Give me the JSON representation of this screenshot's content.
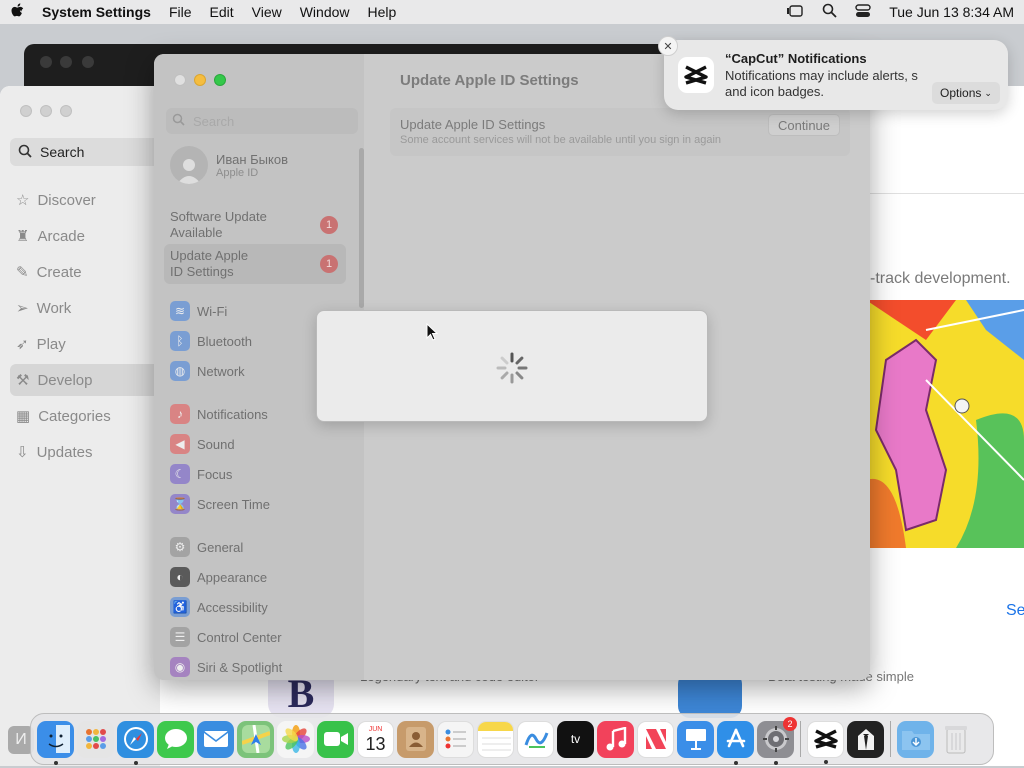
{
  "menubar": {
    "app": "System Settings",
    "items": [
      "File",
      "Edit",
      "View",
      "Window",
      "Help"
    ],
    "clock": "Tue Jun 13  8:34 AM"
  },
  "store": {
    "search": "Search",
    "nav": [
      {
        "label": "Discover",
        "icon": "star-icon"
      },
      {
        "label": "Arcade",
        "icon": "joystick-icon"
      },
      {
        "label": "Create",
        "icon": "brush-icon"
      },
      {
        "label": "Work",
        "icon": "paper-plane-icon"
      },
      {
        "label": "Play",
        "icon": "rocket-icon"
      },
      {
        "label": "Develop",
        "icon": "hammer-icon",
        "selected": true
      },
      {
        "label": "Categories",
        "icon": "grid-icon"
      },
      {
        "label": "Updates",
        "icon": "download-icon"
      }
    ],
    "hero_text": "-track development.",
    "see_link": "Se",
    "app1_text": "Legendary text and code editor",
    "app1_icon_letter": "B",
    "app2_text": "Beta testing made simple"
  },
  "settings": {
    "title": "Update Apple ID Settings",
    "search_placeholder": "Search",
    "profile": {
      "name": "Иван Быков",
      "sub": "Apple ID"
    },
    "alerts": [
      {
        "line1": "Software Update",
        "line2": "Available",
        "badge": "1"
      },
      {
        "line1": "Update Apple",
        "line2": "ID Settings",
        "badge": "1",
        "selected": true
      }
    ],
    "groups": [
      [
        {
          "label": "Wi-Fi",
          "icon": "wifi-icon",
          "color": "#7a9ed3"
        },
        {
          "label": "Bluetooth",
          "icon": "bluetooth-icon",
          "color": "#7a9ed3"
        },
        {
          "label": "Network",
          "icon": "globe-icon",
          "color": "#7a9ed3"
        }
      ],
      [
        {
          "label": "Notifications",
          "icon": "bell-icon",
          "color": "#d98484"
        },
        {
          "label": "Sound",
          "icon": "speaker-icon",
          "color": "#d98484"
        },
        {
          "label": "Focus",
          "icon": "moon-icon",
          "color": "#9486c9"
        },
        {
          "label": "Screen Time",
          "icon": "hourglass-icon",
          "color": "#9486c9"
        }
      ],
      [
        {
          "label": "General",
          "icon": "gear-icon",
          "color": "#a3a3a3"
        },
        {
          "label": "Appearance",
          "icon": "appearance-icon",
          "color": "#5a5a5a"
        },
        {
          "label": "Accessibility",
          "icon": "accessibility-icon",
          "color": "#7a9ed3"
        },
        {
          "label": "Control Center",
          "icon": "control-center-icon",
          "color": "#a3a3a3"
        },
        {
          "label": "Siri & Spotlight",
          "icon": "siri-icon",
          "color": "#a583c0"
        }
      ]
    ],
    "update_row": {
      "title": "Update Apple ID Settings",
      "subtitle": "Some account services will not be available until you sign in again",
      "button": "Continue"
    }
  },
  "notification": {
    "title": "“CapCut” Notifications",
    "line1": "Notifications may include alerts, s",
    "line2": "and icon badges.",
    "options": "Options"
  },
  "dock": {
    "apps": [
      {
        "name": "finder",
        "color": "#3b8ee8",
        "glyph": "☺",
        "running": true
      },
      {
        "name": "launchpad",
        "color": "#e5e5e5",
        "glyph": "▦",
        "running": false
      },
      {
        "name": "safari",
        "color": "#2f8fe0",
        "glyph": "⊕",
        "running": true
      },
      {
        "name": "messages",
        "color": "#3ec94d",
        "glyph": "💬",
        "running": false
      },
      {
        "name": "mail",
        "color": "#3a8de0",
        "glyph": "✉",
        "running": false
      },
      {
        "name": "maps",
        "color": "#6cc06a",
        "glyph": "➤",
        "running": false
      },
      {
        "name": "photos",
        "color": "#f0f0f0",
        "glyph": "✿",
        "running": false
      },
      {
        "name": "facetime",
        "color": "#38c24a",
        "glyph": "▶",
        "running": false
      },
      {
        "name": "calendar",
        "color": "#ffffff",
        "glyph": "13",
        "running": false
      },
      {
        "name": "contacts",
        "color": "#c79b6b",
        "glyph": "☻",
        "running": false
      },
      {
        "name": "reminders",
        "color": "#f5f5f5",
        "glyph": "☰",
        "running": false
      },
      {
        "name": "notes",
        "color": "#f7d74a",
        "glyph": "✎",
        "running": false
      },
      {
        "name": "freeform",
        "color": "#ffffff",
        "glyph": "〰",
        "running": false
      },
      {
        "name": "tv",
        "color": "#111111",
        "glyph": "tv",
        "running": false
      },
      {
        "name": "music",
        "color": "#f2425b",
        "glyph": "♫",
        "running": false
      },
      {
        "name": "news",
        "color": "#f24458",
        "glyph": "N",
        "running": false
      },
      {
        "name": "keynote",
        "color": "#3b8ee8",
        "glyph": "⌂",
        "running": false
      },
      {
        "name": "app-store",
        "color": "#2f8fe8",
        "glyph": "A",
        "running": true
      },
      {
        "name": "system-settings",
        "color": "#8e8e93",
        "glyph": "⚙",
        "running": true,
        "badge": "2"
      }
    ],
    "extras": [
      {
        "name": "capcut",
        "color": "#ffffff",
        "glyph": "✂",
        "running": true
      },
      {
        "name": "bartender",
        "color": "#222222",
        "glyph": "♞",
        "running": false
      }
    ],
    "right": [
      {
        "name": "downloads",
        "color": "#6fb3ea",
        "glyph": "⬇"
      },
      {
        "name": "trash",
        "color": "#e6e6e6",
        "glyph": "🗑"
      }
    ]
  }
}
